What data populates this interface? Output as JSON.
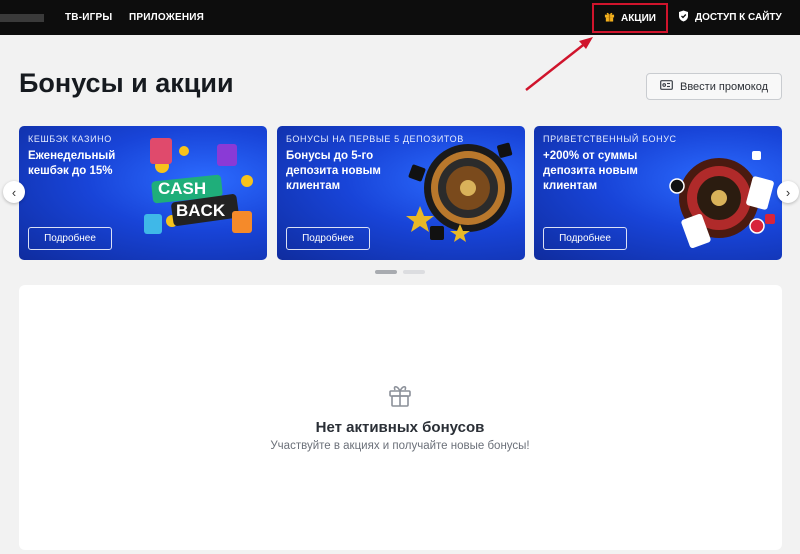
{
  "nav": {
    "items": [
      {
        "label": "ТВ-ИГРЫ"
      },
      {
        "label": "ПРИЛОЖЕНИЯ"
      }
    ],
    "promotions": {
      "label": "АКЦИИ",
      "icon": "gift-icon",
      "highlight_color": "#d0142c"
    },
    "site_access": {
      "label": "ДОСТУП К САЙТУ",
      "icon": "shield-icon"
    }
  },
  "page": {
    "title": "Бонусы и акции",
    "promo_button": {
      "label": "Ввести промокод",
      "icon": "ticket-icon"
    }
  },
  "carousel": {
    "cards": [
      {
        "tag": "КЕШБЭК КАЗИНО",
        "text": "Еженедельный кешбэк до 15%",
        "button": "Подробнее",
        "art_label_1": "CASH",
        "art_label_2": "BACK"
      },
      {
        "tag": "БОНУСЫ НА ПЕРВЫЕ 5 ДЕПОЗИТОВ",
        "text": "Бонусы до 5-го депозита новым клиентам",
        "button": "Подробнее"
      },
      {
        "tag": "ПРИВЕТСТВЕННЫЙ БОНУС",
        "text": "+200% от суммы депозита новым клиентам",
        "button": "Подробнее"
      }
    ],
    "prev_icon": "chevron-left-icon",
    "next_icon": "chevron-right-icon",
    "page_count": 2,
    "active_page": 1
  },
  "empty_state": {
    "icon": "gift-icon",
    "title": "Нет активных бонусов",
    "subtitle": "Участвуйте в акциях и получайте новые бонусы!"
  },
  "colors": {
    "topbar": "#0d0d0d",
    "card_blue": "#1844d8",
    "annotation_red": "#d0142c"
  }
}
